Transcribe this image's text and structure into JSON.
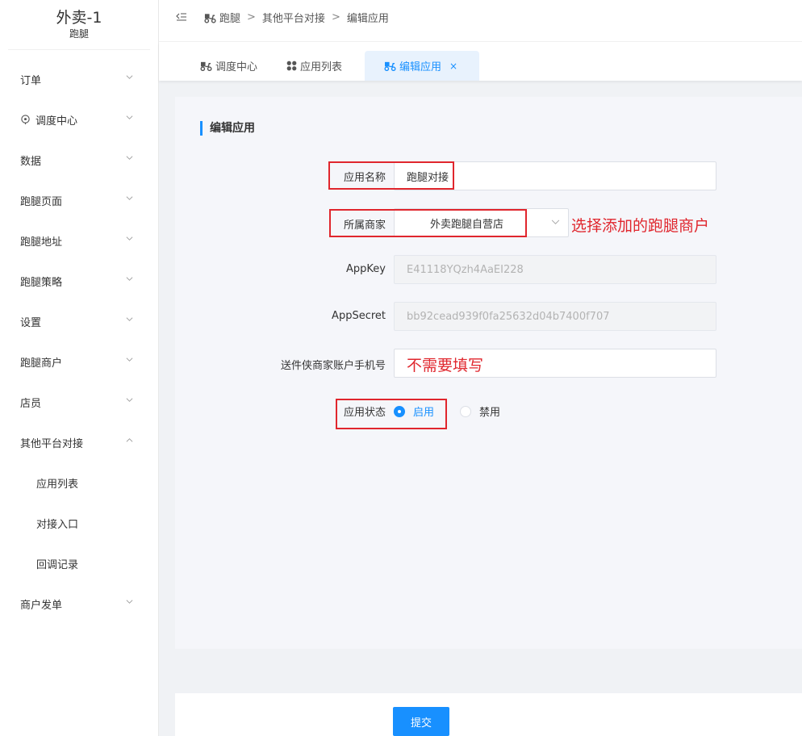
{
  "brand": {
    "title": "外卖-1",
    "subtitle": "跑腿"
  },
  "sidebar": {
    "items": [
      {
        "label": "订单",
        "expanded": false
      },
      {
        "label": "调度中心",
        "expanded": false
      },
      {
        "label": "数据",
        "expanded": false
      },
      {
        "label": "跑腿页面",
        "expanded": false
      },
      {
        "label": "跑腿地址",
        "expanded": false
      },
      {
        "label": "跑腿策略",
        "expanded": false
      },
      {
        "label": "设置",
        "expanded": false
      },
      {
        "label": "跑腿商户",
        "expanded": false
      },
      {
        "label": "店员",
        "expanded": false
      },
      {
        "label": "其他平台对接",
        "expanded": true
      },
      {
        "label": "商户发单",
        "expanded": false
      }
    ],
    "submenu": [
      "应用列表",
      "对接入口",
      "回调记录"
    ]
  },
  "breadcrumb": [
    "跑腿",
    "其他平台对接",
    "编辑应用"
  ],
  "breadcrumb_separator": ">",
  "tabs": [
    {
      "label": "调度中心",
      "active": false
    },
    {
      "label": "应用列表",
      "active": false
    },
    {
      "label": "编辑应用",
      "active": true,
      "close": "×"
    }
  ],
  "form": {
    "section_title": "编辑应用",
    "app_name": {
      "label": "应用名称",
      "value": "跑腿对接"
    },
    "merchant": {
      "label": "所属商家",
      "value": "外卖跑腿自营店"
    },
    "appkey": {
      "label": "AppKey",
      "value": "E41118YQzh4AaEI228"
    },
    "appsecret": {
      "label": "AppSecret",
      "value": "bb92cead939f0fa25632d04b7400f707"
    },
    "phone": {
      "label": "送件侠商家账户手机号",
      "value": ""
    },
    "status": {
      "label": "应用状态",
      "options": [
        "启用",
        "禁用"
      ],
      "selected": "启用"
    },
    "submit_label": "提交"
  },
  "annotations": {
    "merchant_hint": "选择添加的跑腿商户",
    "phone_hint": "不需要填写",
    "color": "#e0262d"
  },
  "colors": {
    "accent": "#1890ff"
  }
}
